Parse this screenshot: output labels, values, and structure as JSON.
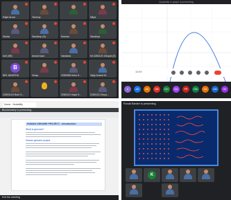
{
  "q1": {
    "tiles": [
      {
        "name": "Rajni Arora"
      },
      {
        "name": "Tanmoy"
      },
      {
        "name": ""
      },
      {
        "name": "Nitya"
      },
      {
        "name": "Sweta"
      },
      {
        "name": "Sandeep (5)"
      },
      {
        "name": "Keshav"
      },
      {
        "name": "Sandhya"
      },
      {
        "name": "Anil (5B)"
      },
      {
        "name": "Anand kaur"
      },
      {
        "name": "Vandana"
      },
      {
        "name": "Nt 2280120 4Gopal (5)"
      },
      {
        "name": "BRI JANATRA"
      },
      {
        "name": "Vinay"
      },
      {
        "name": "2280085 Ashu K..."
      },
      {
        "name": "Vijay Anand M."
      },
      {
        "name": "22803124 Bobi S..."
      },
      {
        "name": ""
      },
      {
        "name": "2280121 Kajal S..."
      },
      {
        "name": "2280101 Divya..."
      }
    ],
    "letter_tile": "B"
  },
  "q2": {
    "title": "Quadratic x² graph is presenting",
    "time": "10:59",
    "avatars": [
      "A",
      "AD",
      "AK",
      "DB",
      "DH",
      "DA",
      "PR",
      "DM",
      "SA",
      "AM",
      "SK"
    ]
  },
  "q3": {
    "tab": "Home - Notability",
    "presenting": "Biochemistry is presenting.",
    "doc_title": "HUMAN GENOME PROJECT - Introduction",
    "sub1": "What is genome?",
    "sub2": "Human genome project",
    "task": "Exit the meeting"
  },
  "q4": {
    "title": "Ronak Banker is presenting",
    "participants": [
      "",
      "K",
      "",
      "",
      "",
      "",
      ""
    ]
  }
}
